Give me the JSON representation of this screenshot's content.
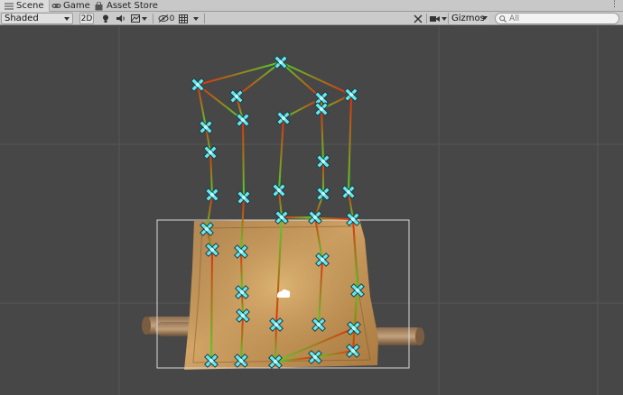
{
  "tabs": [
    {
      "label": "Scene",
      "icon": "scene-grid-icon",
      "active": true
    },
    {
      "label": "Game",
      "icon": "gamepad-icon",
      "active": false
    },
    {
      "label": "Asset Store",
      "icon": "shopping-bag-icon",
      "active": false
    }
  ],
  "toolbar": {
    "draw_mode": "Shaded",
    "two_d_label": "2D",
    "hidden_count": "0",
    "gizmos_label": "Gizmos",
    "search_placeholder": "All"
  },
  "colors": {
    "scene_bg": "#474747",
    "waypoint": "#66e8ee",
    "edge_start": "#e82a0c",
    "edge_end": "#4ad62a",
    "parchment": "#c89a5c"
  }
}
